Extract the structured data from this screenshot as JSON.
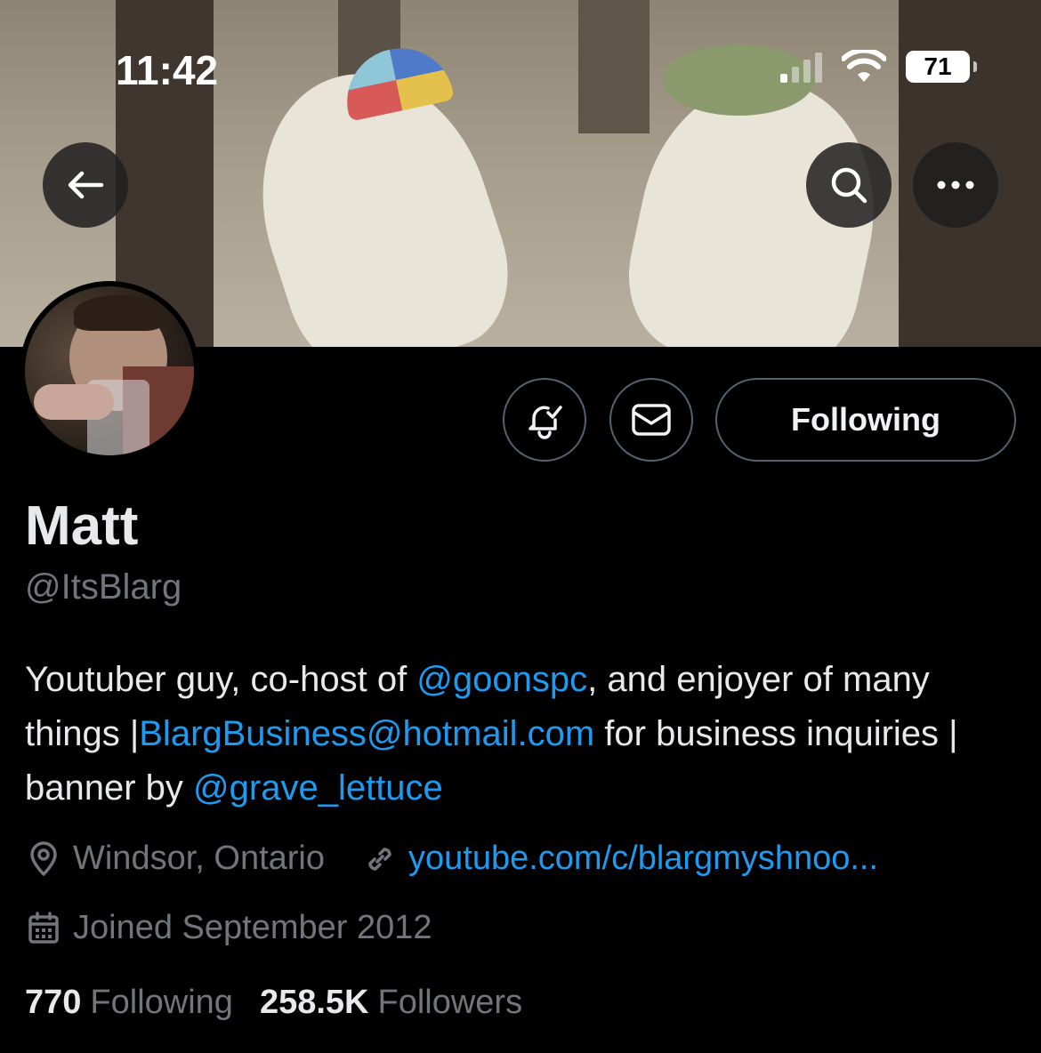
{
  "status_bar": {
    "time": "11:42",
    "battery": "71"
  },
  "header": {
    "back_icon": "arrow-left-icon",
    "search_icon": "search-icon",
    "more_icon": "more-horizontal-icon"
  },
  "profile": {
    "name": "Matt",
    "handle": "@ItsBlarg",
    "bio": {
      "p1": "Youtuber guy, co-host of ",
      "mention1": "@goonspc",
      "p2": ", and enjoyer of many things |",
      "email": "BlargBusiness@hotmail.com",
      "p3": " for business inquiries | banner by ",
      "mention2": "@grave_lettuce"
    },
    "location": "Windsor, Ontario",
    "website": "youtube.com/c/blargmyshnoo...",
    "joined": "Joined September 2012",
    "following_count": "770",
    "following_label": "Following",
    "followers_count": "258.5K",
    "followers_label": "Followers"
  },
  "actions": {
    "notify_icon": "bell-check-icon",
    "message_icon": "mail-icon",
    "following_button": "Following"
  },
  "colors": {
    "link": "#1d9bf0",
    "muted": "#71767b",
    "text": "#e7e9ea",
    "background": "#000000"
  }
}
